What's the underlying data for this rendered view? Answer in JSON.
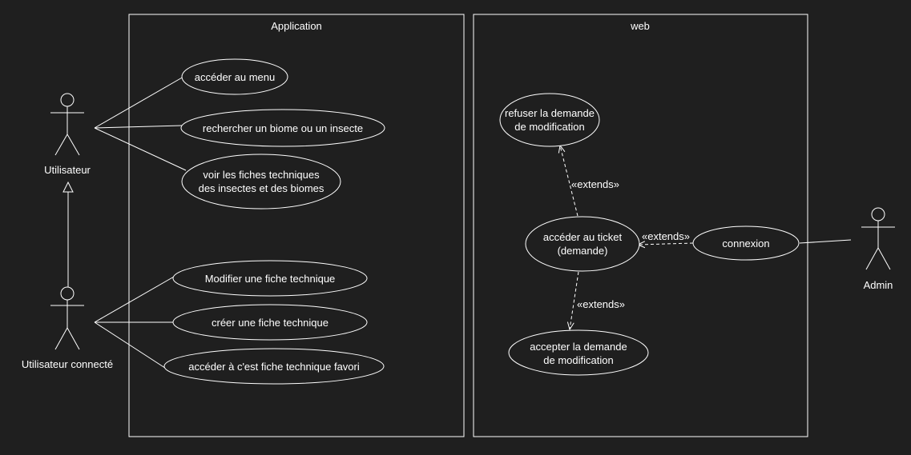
{
  "diagram": {
    "type": "use-case",
    "colors": {
      "background": "#1f1f1f",
      "foreground": "#ffffff"
    },
    "systems": {
      "application": {
        "title": "Application"
      },
      "web": {
        "title": "web"
      }
    },
    "actors": {
      "utilisateur": {
        "label": "Utilisateur"
      },
      "connecte": {
        "label": "Utilisateur connecté"
      },
      "admin": {
        "label": "Admin"
      }
    },
    "use_cases": {
      "menu": {
        "lines": [
          "accéder au menu"
        ]
      },
      "rechercher": {
        "lines": [
          "rechercher un biome ou un insecte"
        ]
      },
      "voir": {
        "lines": [
          "voir les fiches techniques",
          "des insectes et des biomes"
        ]
      },
      "modifier": {
        "lines": [
          "Modifier une fiche technique"
        ]
      },
      "creer": {
        "lines": [
          "créer une fiche technique"
        ]
      },
      "favori": {
        "lines": [
          "accéder à c'est fiche technique favori"
        ]
      },
      "refuser": {
        "lines": [
          "refuser la demande",
          "de modification"
        ]
      },
      "ticket": {
        "lines": [
          "accéder au ticket",
          "(demande)"
        ]
      },
      "connexion": {
        "lines": [
          "connexion"
        ]
      },
      "accepter": {
        "lines": [
          "accepter la demande",
          "de modification"
        ]
      }
    },
    "relations": {
      "extends_refuser": {
        "label": "«extends»"
      },
      "extends_connexion": {
        "label": "«extends»"
      },
      "extends_accepter": {
        "label": "«extends»"
      }
    }
  }
}
